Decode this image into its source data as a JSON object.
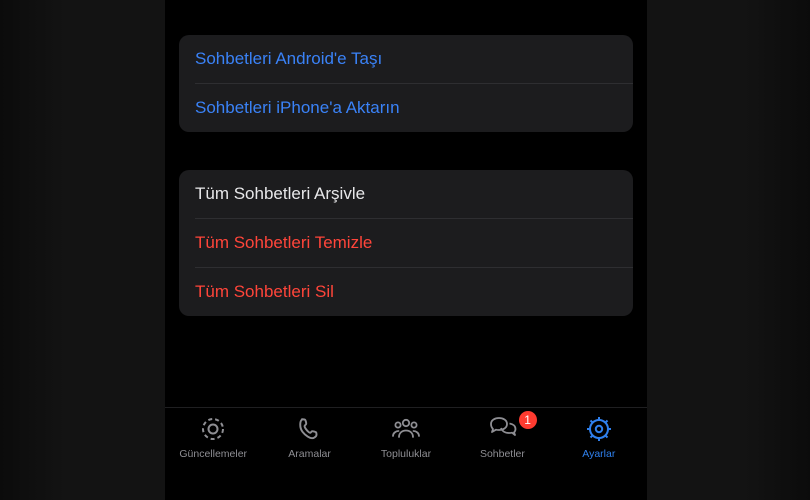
{
  "transfer": {
    "android_label": "Sohbetleri Android'e Taşı",
    "iphone_label": "Sohbetleri iPhone'a Aktarın"
  },
  "actions": {
    "archive_all_label": "Tüm Sohbetleri Arşivle",
    "clear_all_label": "Tüm Sohbetleri Temizle",
    "delete_all_label": "Tüm Sohbetleri Sil"
  },
  "tabs": {
    "updates": "Güncellemeler",
    "calls": "Aramalar",
    "communities": "Topluluklar",
    "chats": "Sohbetler",
    "chats_badge": "1",
    "settings": "Ayarlar"
  },
  "colors": {
    "link_blue": "#3a82f7",
    "danger_red": "#ff453a",
    "badge_red": "#ff3b30",
    "active_blue": "#2f80ed"
  }
}
